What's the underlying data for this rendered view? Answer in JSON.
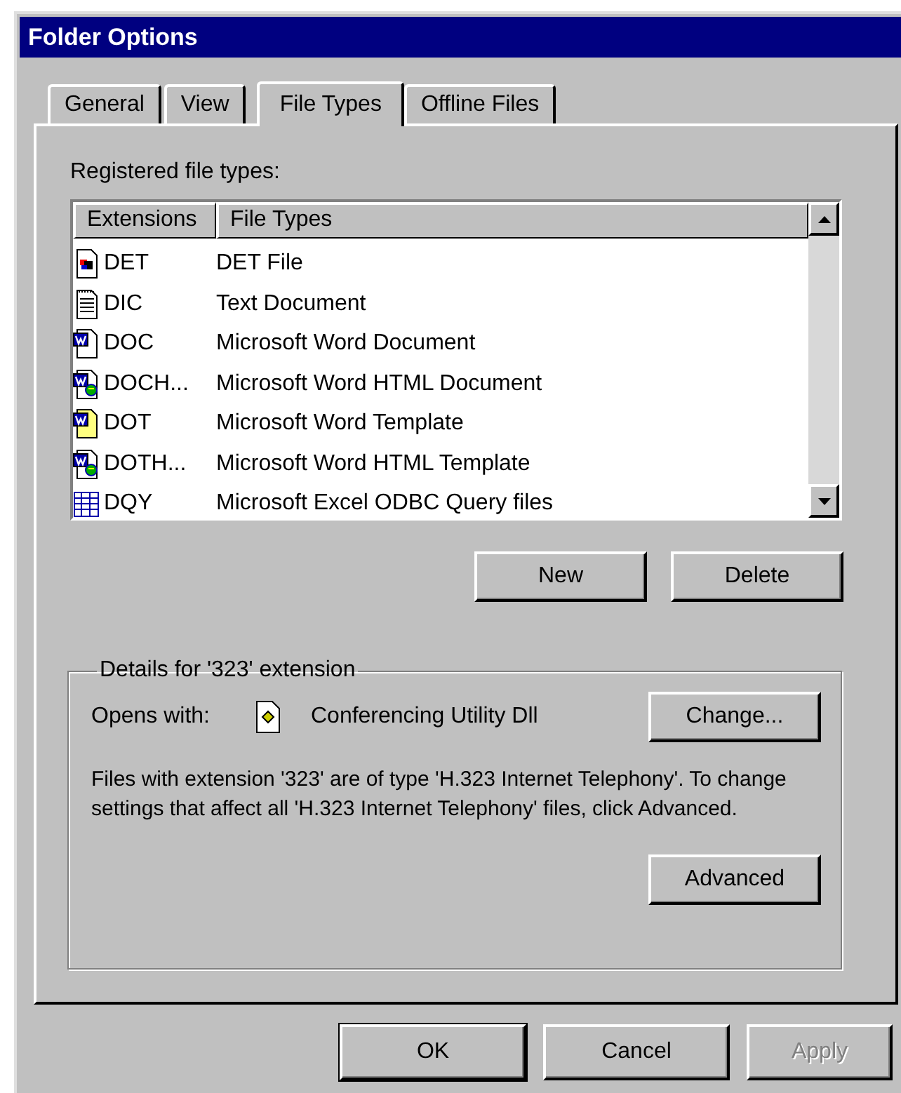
{
  "window": {
    "title": "Folder Options"
  },
  "tabs": [
    {
      "label": "General",
      "selected": false
    },
    {
      "label": "View",
      "selected": false
    },
    {
      "label": "File Types",
      "selected": true
    },
    {
      "label": "Offline Files",
      "selected": false
    }
  ],
  "file_types": {
    "label": "Registered file types:",
    "columns": [
      "Extensions",
      "File Types"
    ],
    "rows": [
      {
        "kind": "media",
        "extension": "DET",
        "type": "DET File"
      },
      {
        "kind": "text",
        "extension": "DIC",
        "type": "Text Document"
      },
      {
        "kind": "word",
        "extension": "DOC",
        "type": "Microsoft Word Document"
      },
      {
        "kind": "word-html",
        "extension": "DOCH...",
        "type": "Microsoft Word HTML Document"
      },
      {
        "kind": "word-template",
        "extension": "DOT",
        "type": "Microsoft Word Template"
      },
      {
        "kind": "word-html",
        "extension": "DOTH...",
        "type": "Microsoft Word HTML Template"
      },
      {
        "kind": "query",
        "extension": "DQY",
        "type": "Microsoft Excel ODBC Query files"
      }
    ]
  },
  "list_buttons": [
    "New",
    "Delete"
  ],
  "details": {
    "title": "Details for '323' extension",
    "opens_with_label": "Opens with:",
    "program": "Conferencing Utility Dll",
    "change_button": "Change...",
    "description": "Files with extension '323' are of type 'H.323 Internet Telephony'. To change settings that affect all 'H.323 Internet Telephony' files, click Advanced.",
    "advanced_button": "Advanced"
  },
  "dialog_buttons": [
    {
      "label": "OK",
      "default": true,
      "disabled": false
    },
    {
      "label": "Cancel",
      "default": false,
      "disabled": false
    },
    {
      "label": "Apply",
      "default": false,
      "disabled": true
    }
  ]
}
